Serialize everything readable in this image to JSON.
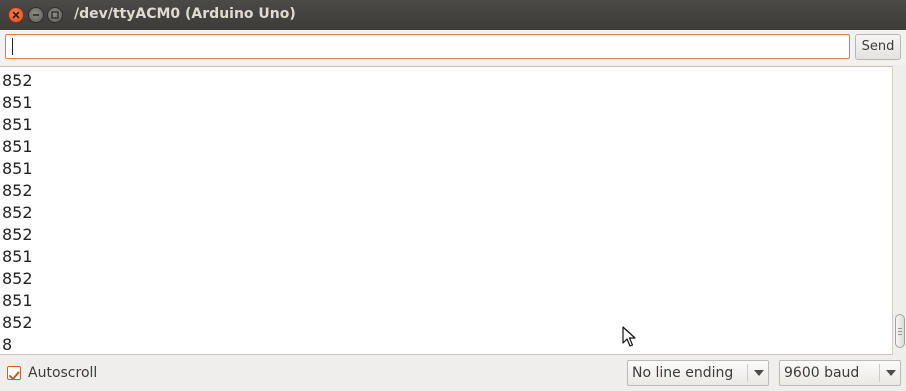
{
  "window": {
    "title": "/dev/ttyACM0 (Arduino Uno)",
    "buttons": [
      "close-icon",
      "minimize-icon",
      "maximize-icon"
    ]
  },
  "input": {
    "value": "",
    "send_label": "Send"
  },
  "output": {
    "lines": [
      "852",
      "851",
      "851",
      "851",
      "851",
      "852",
      "852",
      "852",
      "851",
      "852",
      "851",
      "852",
      "8"
    ]
  },
  "footer": {
    "autoscroll_label": "Autoscroll",
    "autoscroll_checked": true,
    "line_ending": "No line ending",
    "baud_rate": "9600 baud"
  },
  "colors": {
    "titlebar": "#3c3b37",
    "close_button": "#df4b17",
    "accent_border": "#e07b53"
  }
}
